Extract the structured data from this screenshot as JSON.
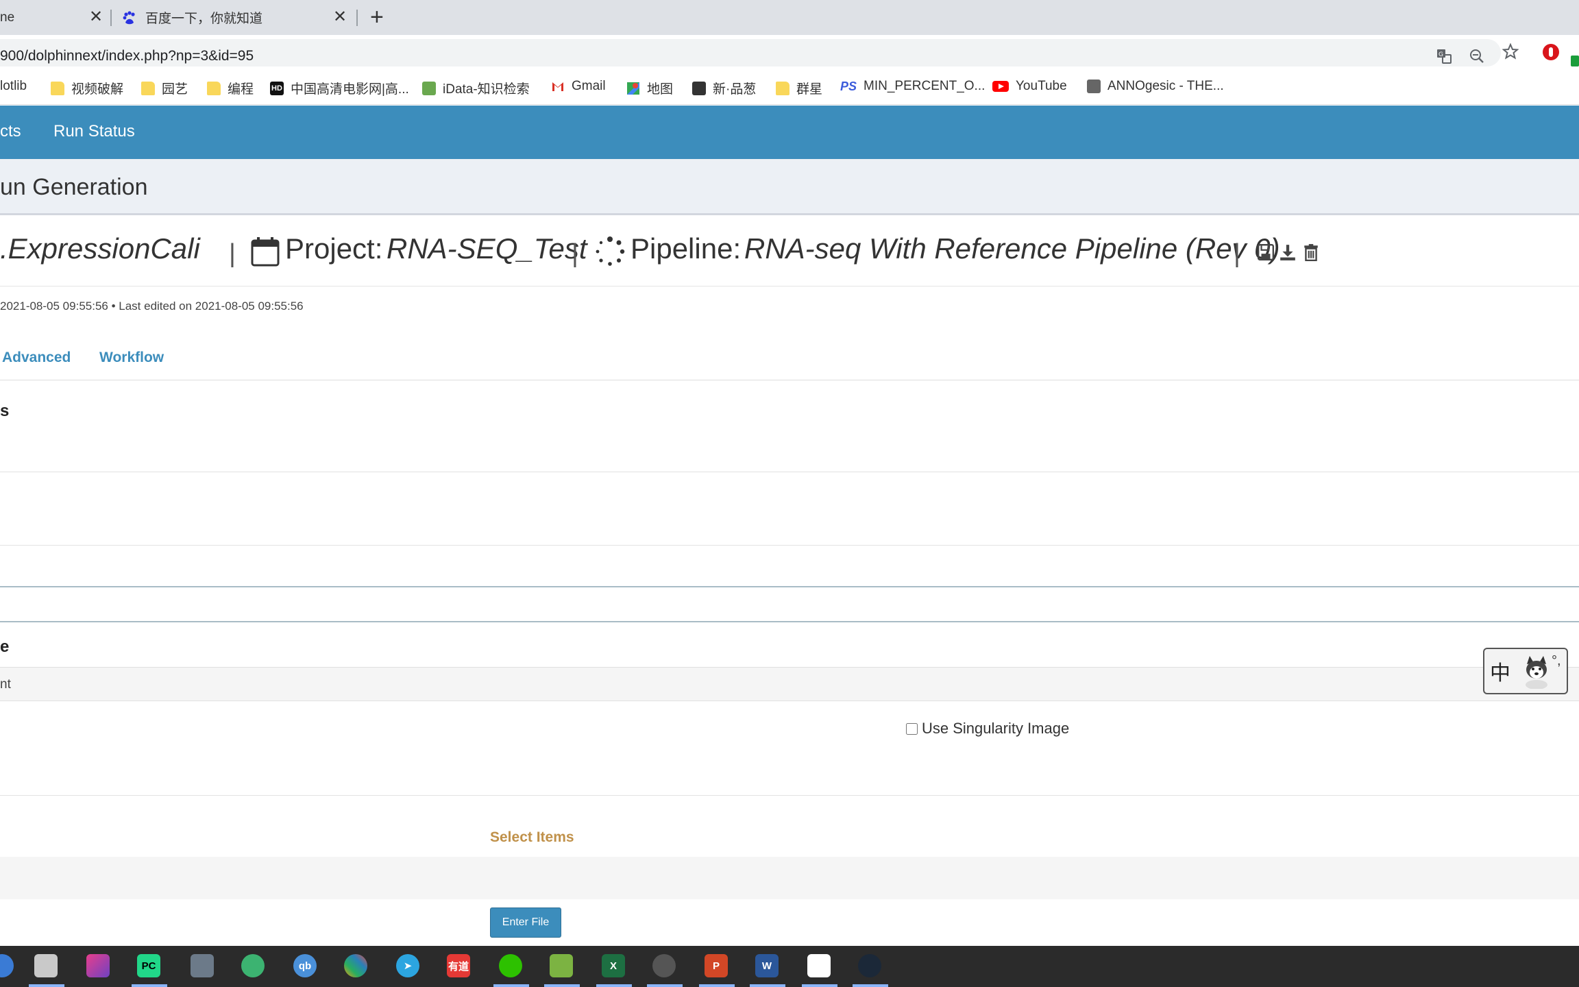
{
  "browser": {
    "tabs": [
      {
        "title": "ne"
      },
      {
        "title": "百度一下，你就知道"
      }
    ],
    "url": "900/dolphinnext/index.php?np=3&id=95",
    "bookmarks": [
      {
        "label": "lotlib"
      },
      {
        "label": "视频破解"
      },
      {
        "label": "园艺"
      },
      {
        "label": "编程"
      },
      {
        "label": "中国高清电影网|高..."
      },
      {
        "label": "iData-知识检索"
      },
      {
        "label": "Gmail"
      },
      {
        "label": "地图"
      },
      {
        "label": "新·品葱"
      },
      {
        "label": "群星"
      },
      {
        "label": "MIN_PERCENT_O..."
      },
      {
        "label": "YouTube"
      },
      {
        "label": "ANNOgesic - THE..."
      }
    ]
  },
  "navbar": {
    "items": [
      "cts",
      "Run Status"
    ]
  },
  "header": {
    "title": "un Generation"
  },
  "run": {
    "name": ".ExpressionCali",
    "project_label": "Project:",
    "project_value": "RNA-SEQ_Test",
    "pipeline_label": "Pipeline:",
    "pipeline_value": "RNA-seq With Reference Pipeline (Rev 0)",
    "meta": "2021-08-05 09:55:56 • Last edited on 2021-08-05 09:55:56"
  },
  "tabs": [
    "Advanced",
    "Workflow"
  ],
  "sections": {
    "s_heading": "s",
    "e_heading": "e",
    "grey_row": "nt",
    "singularity_label": "Use Singularity Image",
    "select_items": "Select Items",
    "enter_file": "Enter File"
  },
  "ime": {
    "char": "中",
    "punct": "°,"
  },
  "taskbar": {
    "youdao_label": "有道",
    "qb_label": "qb"
  },
  "colors": {
    "navbar": "#3c8dbc",
    "accent_orange": "#c0914a",
    "header_bg": "#ecf0f5"
  }
}
